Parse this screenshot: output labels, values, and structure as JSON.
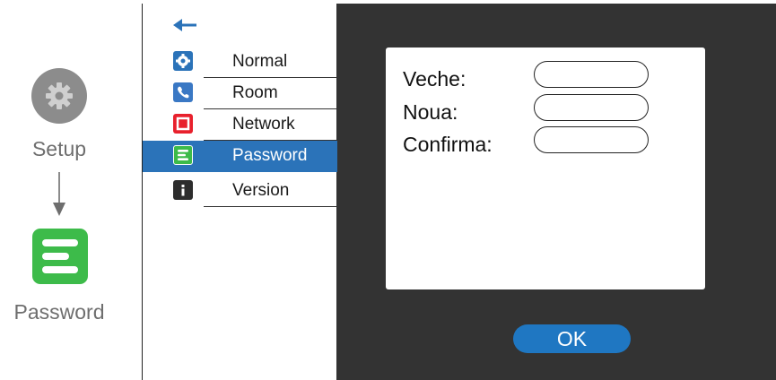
{
  "legend": {
    "setup_label": "Setup",
    "password_label": "Password"
  },
  "menu": {
    "back_icon": "left-arrow-icon",
    "items": [
      {
        "label": "Normal",
        "icon": "gear-icon",
        "color": "#2b73b9",
        "selected": false
      },
      {
        "label": "Room",
        "icon": "phone-icon",
        "color": "#3a78c4",
        "selected": false
      },
      {
        "label": "Network",
        "icon": "square-icon",
        "color": "#e8202c",
        "selected": false
      },
      {
        "label": "Password",
        "icon": "lines-icon",
        "color": "#3dbb4a",
        "selected": true
      },
      {
        "label": "Version",
        "icon": "info-icon",
        "color": "#2d2d2d",
        "selected": false
      }
    ]
  },
  "form": {
    "fields": [
      {
        "label": "Veche:",
        "value": ""
      },
      {
        "label": "Noua:",
        "value": ""
      },
      {
        "label": "Confirma:",
        "value": ""
      }
    ],
    "ok_label": "OK"
  },
  "colors": {
    "selected_bg": "#2b73b9",
    "screen_bg": "#333333",
    "ok_button": "#1f77c2",
    "password_green": "#3dbb4a",
    "setup_gray": "#8c8c8c"
  }
}
